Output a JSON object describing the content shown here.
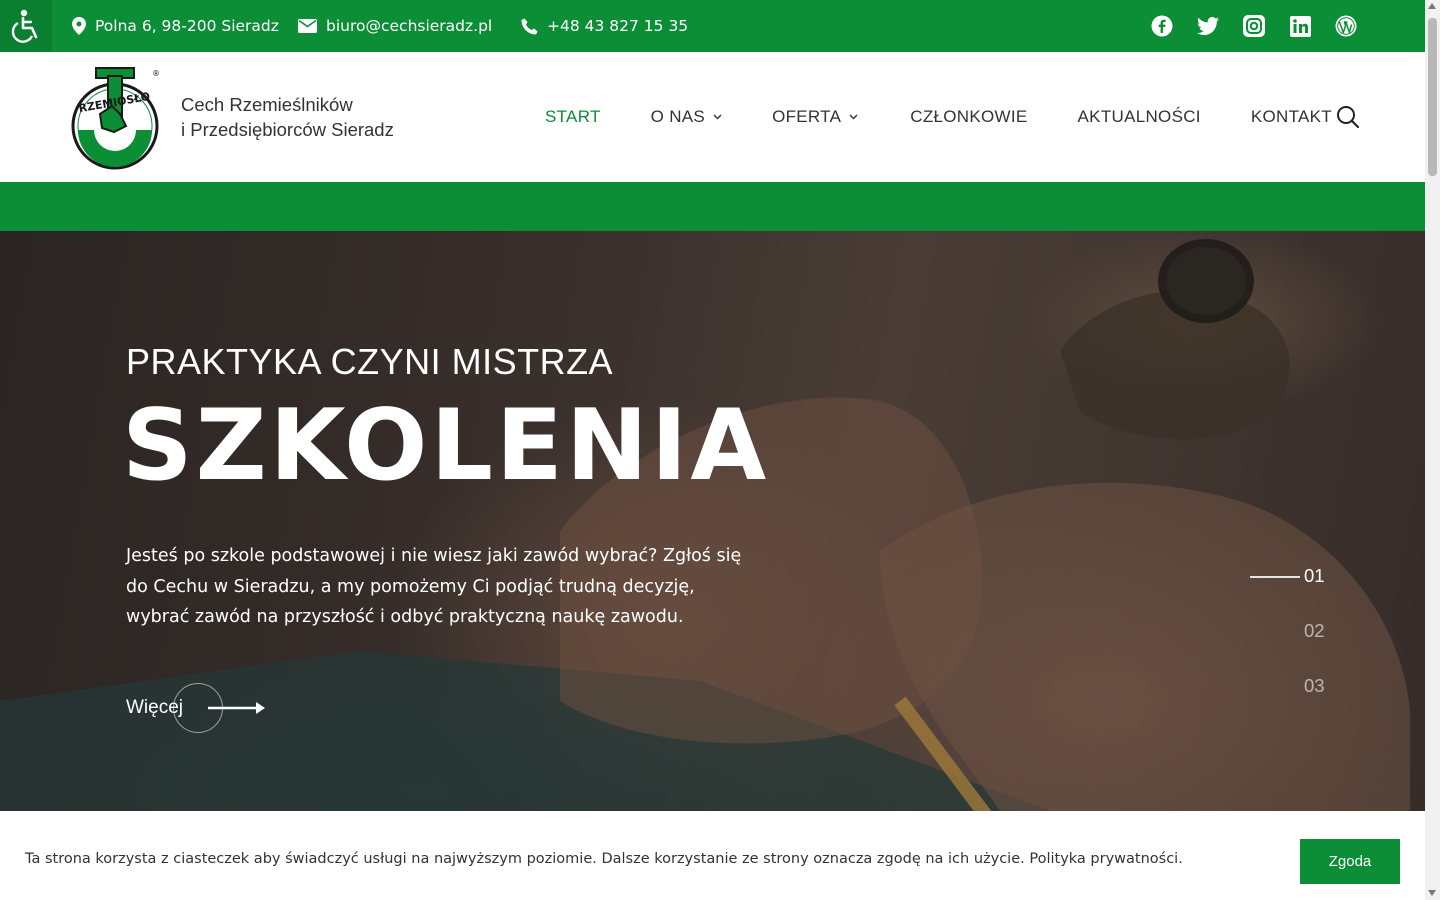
{
  "topbar": {
    "address": "Polna 6, 98-200 Sieradz",
    "email": "biuro@cechsieradz.pl",
    "phone": "+48 43 827 15 35",
    "socials": [
      "facebook-icon",
      "twitter-icon",
      "instagram-icon",
      "linkedin-icon",
      "wordpress-icon"
    ]
  },
  "header": {
    "logo_text": "RZEMIOSŁO",
    "logo_mark": "®",
    "brand_line1": "Cech Rzemieślników",
    "brand_line2": "i Przedsiębiorców Sieradz",
    "nav": [
      {
        "label": "START",
        "active": true
      },
      {
        "label": "O NAS",
        "dropdown": true
      },
      {
        "label": "OFERTA",
        "dropdown": true
      },
      {
        "label": "CZŁONKOWIE"
      },
      {
        "label": "AKTUALNOŚCI"
      },
      {
        "label": "KONTAKT"
      }
    ]
  },
  "hero": {
    "subtitle": "PRAKTYKA CZYNI MISTRZA",
    "title": "SZKOLENIA",
    "text": "Jesteś po szkole podstawowej i nie wiesz jaki zawód wybrać? Zgłoś się do Cechu w Sieradzu, a my pomożemy Ci podjąć trudną decyzję, wybrać zawód na przyszłość i odbyć praktyczną naukę zawodu.",
    "more_label": "Więcej",
    "slides": [
      "01",
      "02",
      "03"
    ],
    "active_slide": 0
  },
  "cookie": {
    "text": "Ta strona korzysta z ciasteczek aby świadczyć usługi na najwyższym poziomie. Dalsze korzystanie ze strony oznacza zgodę na ich użycie. Polityka prywatności.",
    "button": "Zgoda"
  },
  "colors": {
    "brand_green": "#0b8e36",
    "text_dark": "#333333"
  }
}
